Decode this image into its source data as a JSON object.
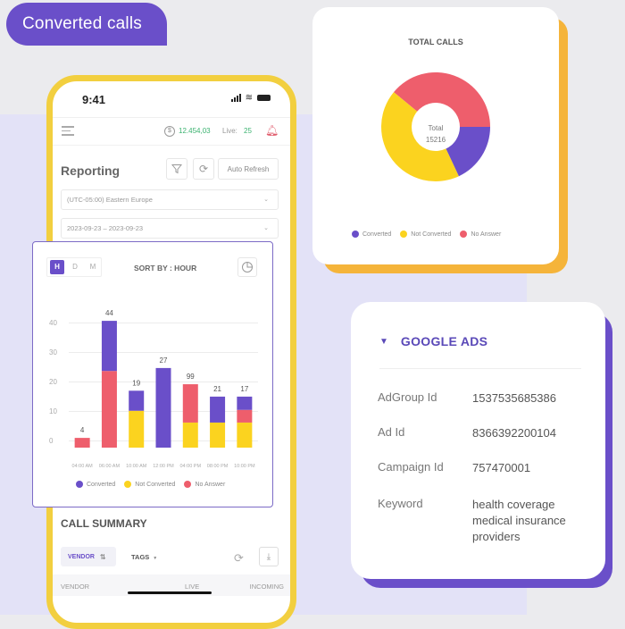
{
  "headline": "Converted calls",
  "phone": {
    "status_time": "9:41",
    "balance": "12.454,03",
    "live_label": "Live:",
    "live_count": "25",
    "reporting_title": "Reporting",
    "auto_refresh_label": "Auto Refresh",
    "timezone_value": "(UTC-05:00) Eastern Europe",
    "date_range_value": "2023-09-23 – 2023-09-23",
    "call_summary_title": "CALL SUMMARY",
    "vendor_chip_label": "VENDOR",
    "tags_label": "TAGS",
    "table_headers": [
      "VENDOR",
      "LIVE",
      "INCOMING"
    ]
  },
  "bar_card": {
    "toggle": [
      "H",
      "D",
      "M"
    ],
    "toggle_active": "H",
    "sort_by_label": "SORT BY : HOUR"
  },
  "donut_card": {
    "title": "TOTAL CALLS",
    "center_label": "Total",
    "center_value": "15216"
  },
  "colors": {
    "converted": "#6a4fc9",
    "not_converted": "#fbd31f",
    "no_answer": "#ee5e6c",
    "accent": "#6a4fc9",
    "phone_frame": "#f2cf3f",
    "donut_shadow": "#f5b43a"
  },
  "google_ads": {
    "title": "GOOGLE ADS",
    "rows": [
      {
        "key": "AdGroup Id",
        "value": "1537535685386"
      },
      {
        "key": "Ad Id",
        "value": "8366392200104"
      },
      {
        "key": "Campaign Id",
        "value": "757470001"
      },
      {
        "key": "Keyword",
        "value": "health coverage medical insurance providers"
      }
    ]
  },
  "chart_data": [
    {
      "type": "bar",
      "stacked": true,
      "title": "SORT BY : HOUR",
      "categories": [
        "04:00 AM",
        "06:00 AM",
        "10:00 AM",
        "12:00 PM",
        "04:00 PM",
        "08:00 PM",
        "10:00 PM"
      ],
      "data_labels": [
        "4",
        "44",
        "19",
        "27",
        "99",
        "21",
        "17"
      ],
      "series": [
        {
          "name": "Not Converted",
          "values": [
            0,
            0,
            12.5,
            0,
            8.5,
            8.5,
            8.5
          ]
        },
        {
          "name": "No Answer",
          "values": [
            3.3,
            26,
            0,
            0,
            13,
            0,
            4.3
          ]
        },
        {
          "name": "Converted",
          "values": [
            0,
            17,
            6.8,
            27,
            0,
            8.8,
            4.5
          ]
        }
      ],
      "yticks": [
        0,
        10,
        20,
        30,
        40
      ],
      "ylim": [
        0,
        44
      ],
      "grid": true,
      "legend": [
        "Converted",
        "Not Converted",
        "No Answer"
      ],
      "legend_position": "bottom"
    },
    {
      "type": "pie",
      "donut": true,
      "title": "TOTAL CALLS",
      "center_text": "Total 15216",
      "labels": [
        "Converted",
        "Not Converted",
        "No Answer"
      ],
      "values_percent": [
        18,
        43,
        39
      ],
      "legend_position": "bottom"
    }
  ]
}
